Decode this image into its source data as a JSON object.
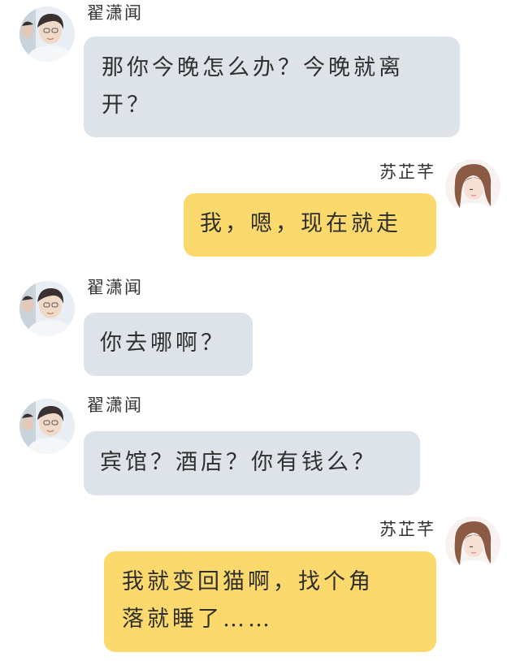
{
  "conversation": {
    "messages": [
      {
        "sender": "翟潇闻",
        "side": "left",
        "bubble_color": "#dde3e9",
        "avatar": "male-avatar",
        "lines": [
          "那你今晚怎么办？今晚就离",
          "开？"
        ]
      },
      {
        "sender": "苏芷芊",
        "side": "right",
        "bubble_color": "#fbd96c",
        "avatar": "female-avatar",
        "lines": [
          "我，嗯，现在就走"
        ]
      },
      {
        "sender": "翟潇闻",
        "side": "left",
        "bubble_color": "#dde3e9",
        "avatar": "male-avatar",
        "lines": [
          "你去哪啊？"
        ]
      },
      {
        "sender": "翟潇闻",
        "side": "left",
        "bubble_color": "#dde3e9",
        "avatar": "male-avatar",
        "lines": [
          "宾馆？酒店？你有钱么？"
        ]
      },
      {
        "sender": "苏芷芊",
        "side": "right",
        "bubble_color": "#fbd96c",
        "avatar": "female-avatar",
        "lines": [
          "我就变回猫啊，找个角",
          "落就睡了……"
        ]
      }
    ]
  }
}
